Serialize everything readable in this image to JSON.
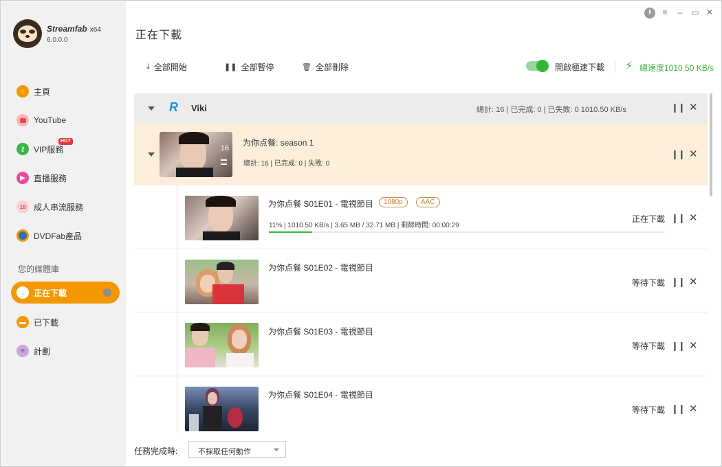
{
  "app": {
    "brand": "Streamfab",
    "arch": "x64",
    "version": "6.0.0.0"
  },
  "window_controls": {
    "minimize": "–",
    "maximize": "▭",
    "menu": "≡",
    "close": "✕"
  },
  "sidebar": {
    "items": [
      {
        "label": "主頁",
        "icon": "home-icon",
        "color": "#f39800"
      },
      {
        "label": "YouTube",
        "icon": "youtube-icon",
        "color": "#e84b4b"
      },
      {
        "label": "VIP服務",
        "icon": "key-icon",
        "color": "#39b54a",
        "badge": "HOT"
      },
      {
        "label": "直播服務",
        "icon": "live-camera-icon",
        "color": "#e64aa0"
      },
      {
        "label": "成人串流服務",
        "icon": "adult-18-icon",
        "color": "#e84b4b"
      },
      {
        "label": "DVDFab產品",
        "icon": "dvdfab-icon",
        "color": "#2d6fb8"
      }
    ],
    "library_label": "您的媒體庫",
    "library": [
      {
        "label": "正在下載",
        "icon": "download-icon",
        "active": true
      },
      {
        "label": "已下載",
        "icon": "folder-icon",
        "color": "#f39800"
      },
      {
        "label": "計劃",
        "icon": "schedule-icon",
        "color": "#9b59b6"
      }
    ]
  },
  "main": {
    "title": "正在下載",
    "toolbar": {
      "start_all": "全部開始",
      "pause_all": "全部暫停",
      "delete_all": "全部刪除",
      "turbo_label": "開啟極速下載",
      "turbo_on": true,
      "total_speed": "總速度1010.50 KB/s"
    },
    "group": {
      "name": "Viki",
      "stats": "總計: 16 | 已完成: 0 | 已失敗: 0    1010.50 KB/s"
    },
    "season": {
      "title": "为你点餐: season 1",
      "count": "16",
      "stats": "總計:  16  |  已完成:  0  |  失敗:  0"
    },
    "episodes": [
      {
        "title": "为你点餐 S01E01 - 電視節目",
        "badges": [
          "1080p",
          "AAC"
        ],
        "progress_text": "11%  |  1010.50 KB/s  |  3.65 MB / 32.71 MB  |  剩餘時間:  00:00:29",
        "progress": 0.11,
        "status": "正在下載"
      },
      {
        "title": "为你点餐 S01E02 - 電視節目",
        "status": "等待下載"
      },
      {
        "title": "为你点餐 S01E03 - 電視節目",
        "status": "等待下載"
      },
      {
        "title": "为你点餐 S01E04 - 電視節目",
        "status": "等待下載"
      }
    ]
  },
  "footer": {
    "on_complete_label": "任務完成時:",
    "on_complete_value": "不採取任何動作"
  }
}
